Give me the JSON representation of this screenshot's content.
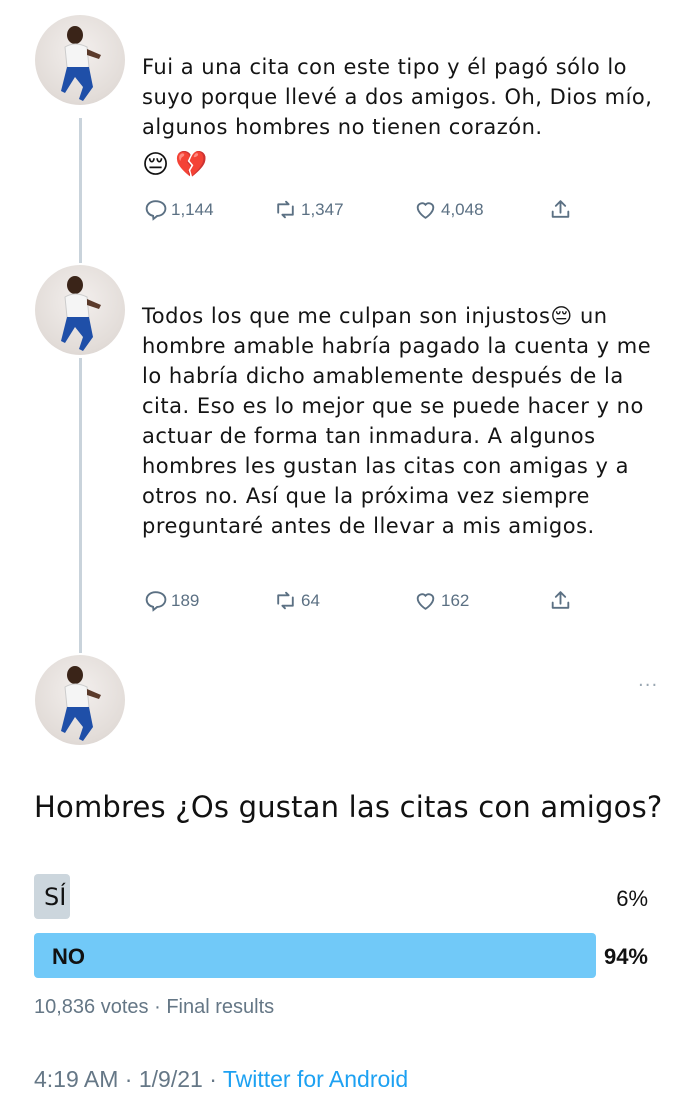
{
  "tweets": [
    {
      "text": "Fui a una cita con este tipo y él pagó sólo lo suyo porque llevé a dos amigos. Oh, Dios mío, algunos hombres no tienen corazón.",
      "emojis": [
        "😔",
        "💔"
      ],
      "replies": "1,144",
      "retweets": "1,347",
      "likes": "4,048"
    },
    {
      "text": "Todos los que me culpan son injustos😔 un hombre amable habría pagado la cuenta y me lo habría dicho amablemente después de la cita. Eso es lo mejor que se puede hacer y no actuar de forma tan inmadura. A algunos hombres les gustan las citas con amigas y a otros no. Así que la próxima vez siempre preguntaré antes de llevar a mis amigos.",
      "replies": "189",
      "retweets": "64",
      "likes": "162"
    }
  ],
  "more_label": "...",
  "poll": {
    "question": "Hombres ¿Os gustan las citas con amigos?",
    "options": [
      {
        "label": "SÍ",
        "percent": "6%",
        "share": 0.06
      },
      {
        "label": "NO",
        "percent": "94%",
        "share": 0.94
      }
    ],
    "votes": "10,836 votes",
    "status": "Final results",
    "separator": "·"
  },
  "footer": {
    "time": "4:19 AM",
    "date": "1/9/21",
    "separator": "·",
    "source": "Twitter for Android"
  },
  "colors": {
    "accent": "#1da1f2",
    "winner_bar": "#71c9f8",
    "loser_bar": "#ccd6dd",
    "muted": "#657786"
  }
}
